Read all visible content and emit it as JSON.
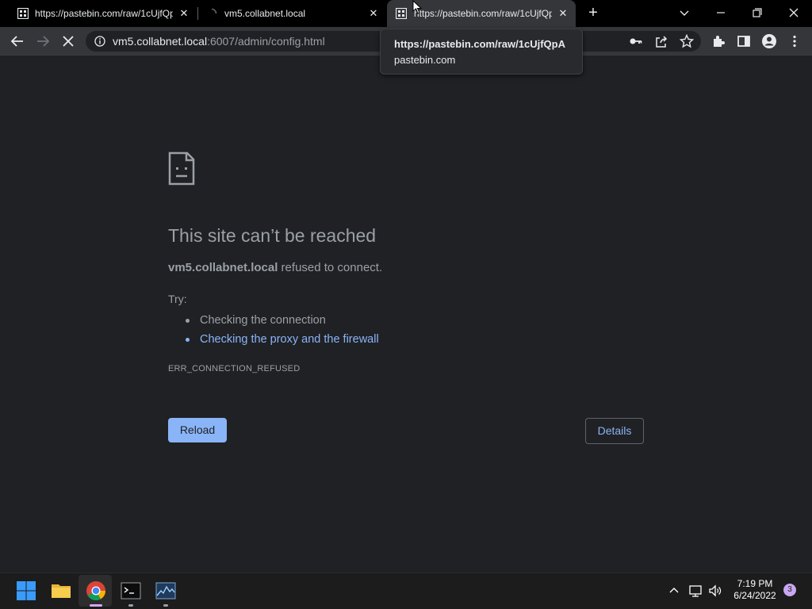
{
  "browser": {
    "tabs": [
      {
        "title": "https://pastebin.com/raw/1cUjfQpA",
        "state": "inactive"
      },
      {
        "title": "vm5.collabnet.local",
        "state": "inactive-loading"
      },
      {
        "title": "https://pastebin.com/raw/1cUjfQpA",
        "state": "active"
      }
    ],
    "new_tab_label": "+",
    "address_bar": {
      "host": "vm5.collabnet.local",
      "path": ":6007/admin/config.html"
    },
    "tooltip": {
      "title": "https://pastebin.com/raw/1cUjfQpA",
      "domain": "pastebin.com"
    }
  },
  "error_page": {
    "title": "This site can’t be reached",
    "host": "vm5.collabnet.local",
    "summary_suffix": " refused to connect.",
    "try_label": "Try:",
    "suggestions": [
      {
        "text": "Checking the connection",
        "is_link": false
      },
      {
        "text": "Checking the proxy and the firewall",
        "is_link": true
      }
    ],
    "error_code": "ERR_CONNECTION_REFUSED",
    "reload_label": "Reload",
    "details_label": "Details"
  },
  "taskbar": {
    "time": "7:19 PM",
    "date": "6/24/2022",
    "notification_count": "3",
    "apps": [
      "start-icon",
      "file-explorer-icon",
      "chrome-icon",
      "terminal-icon",
      "task-manager-icon"
    ]
  },
  "colors": {
    "accent": "#8ab4f8",
    "background": "#202124",
    "tab_strip": "#000000",
    "toolbar": "#35363a"
  }
}
